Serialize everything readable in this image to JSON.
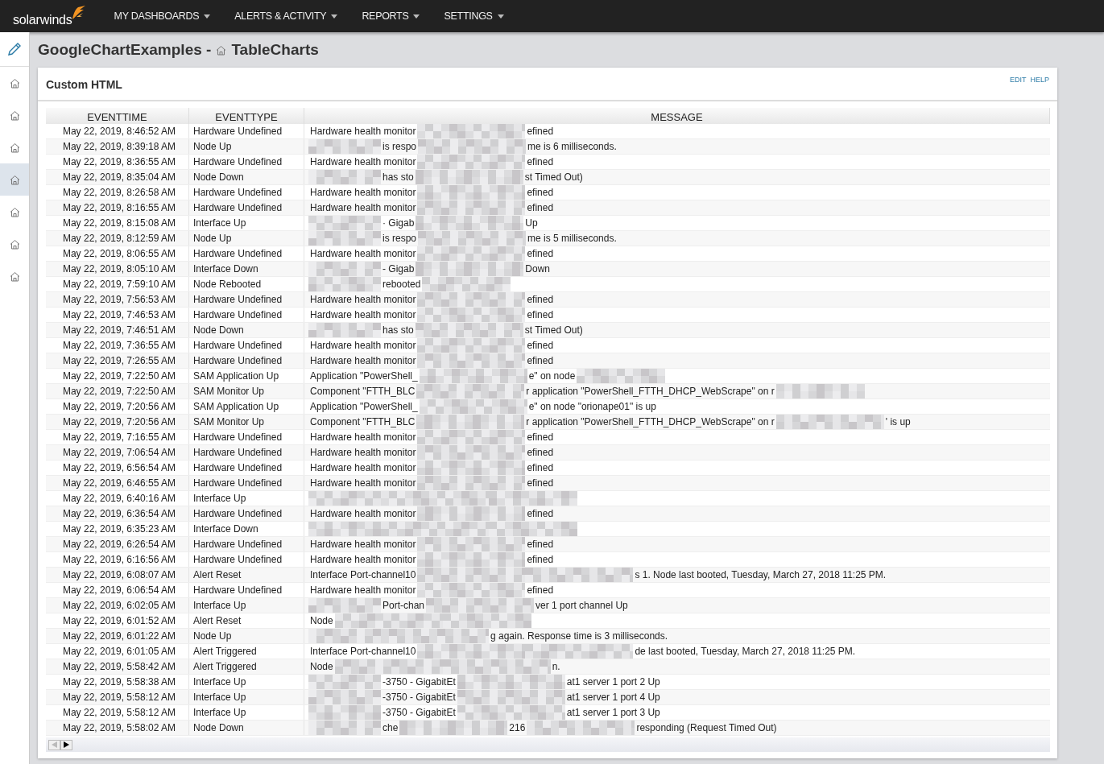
{
  "topbar": {
    "logo": "solarwinds",
    "menu": [
      {
        "label": "MY DASHBOARDS"
      },
      {
        "label": "ALERTS & ACTIVITY"
      },
      {
        "label": "REPORTS"
      },
      {
        "label": "SETTINGS"
      }
    ]
  },
  "sidebar": {
    "items": [
      {
        "selected": false
      },
      {
        "selected": false
      },
      {
        "selected": false
      },
      {
        "selected": true
      },
      {
        "selected": false
      },
      {
        "selected": false
      },
      {
        "selected": false
      }
    ]
  },
  "page": {
    "title": "GoogleChartExamples -",
    "subtitle": "TableCharts"
  },
  "panel": {
    "title": "Custom HTML",
    "links": [
      "EDIT",
      "HELP"
    ]
  },
  "table": {
    "columns": [
      "EVENTTIME",
      "EVENTTYPE",
      "MESSAGE"
    ],
    "rows": [
      {
        "time": "May 22, 2019, 8:46:52 AM",
        "type": "Hardware Undefined",
        "message": [
          {
            "kind": "text",
            "text": "Hardware health monitor"
          },
          {
            "kind": "redacted"
          },
          {
            "kind": "text",
            "text": "efined"
          }
        ]
      },
      {
        "time": "May 22, 2019, 8:39:18 AM",
        "type": "Node Up",
        "message": [
          {
            "kind": "redacted"
          },
          {
            "kind": "text",
            "text": "is respo"
          },
          {
            "kind": "redacted"
          },
          {
            "kind": "text",
            "text": "me is 6 milliseconds."
          }
        ]
      },
      {
        "time": "May 22, 2019, 8:36:55 AM",
        "type": "Hardware Undefined",
        "message": [
          {
            "kind": "text",
            "text": "Hardware health monitor"
          },
          {
            "kind": "redacted"
          },
          {
            "kind": "text",
            "text": "efined"
          }
        ]
      },
      {
        "time": "May 22, 2019, 8:35:04 AM",
        "type": "Node Down",
        "message": [
          {
            "kind": "redacted"
          },
          {
            "kind": "text",
            "text": "has sto"
          },
          {
            "kind": "redacted"
          },
          {
            "kind": "text",
            "text": "st Timed Out)"
          }
        ]
      },
      {
        "time": "May 22, 2019, 8:26:58 AM",
        "type": "Hardware Undefined",
        "message": [
          {
            "kind": "text",
            "text": "Hardware health monitor"
          },
          {
            "kind": "redacted"
          },
          {
            "kind": "text",
            "text": "efined"
          }
        ]
      },
      {
        "time": "May 22, 2019, 8:16:55 AM",
        "type": "Hardware Undefined",
        "message": [
          {
            "kind": "text",
            "text": "Hardware health monitor"
          },
          {
            "kind": "redacted"
          },
          {
            "kind": "text",
            "text": "efined"
          }
        ]
      },
      {
        "time": "May 22, 2019, 8:15:08 AM",
        "type": "Interface Up",
        "message": [
          {
            "kind": "redacted"
          },
          {
            "kind": "text",
            "text": "· Gigab"
          },
          {
            "kind": "redacted"
          },
          {
            "kind": "text",
            "text": "Up"
          }
        ]
      },
      {
        "time": "May 22, 2019, 8:12:59 AM",
        "type": "Node Up",
        "message": [
          {
            "kind": "redacted"
          },
          {
            "kind": "text",
            "text": "is respo"
          },
          {
            "kind": "redacted"
          },
          {
            "kind": "text",
            "text": "me is 5 milliseconds."
          }
        ]
      },
      {
        "time": "May 22, 2019, 8:06:55 AM",
        "type": "Hardware Undefined",
        "message": [
          {
            "kind": "text",
            "text": "Hardware health monitor"
          },
          {
            "kind": "redacted"
          },
          {
            "kind": "text",
            "text": "efined"
          }
        ]
      },
      {
        "time": "May 22, 2019, 8:05:10 AM",
        "type": "Interface Down",
        "message": [
          {
            "kind": "redacted"
          },
          {
            "kind": "text",
            "text": "- Gigab"
          },
          {
            "kind": "redacted"
          },
          {
            "kind": "text",
            "text": "Down"
          }
        ]
      },
      {
        "time": "May 22, 2019, 7:59:10 AM",
        "type": "Node Rebooted",
        "message": [
          {
            "kind": "redacted"
          },
          {
            "kind": "text",
            "text": "rebooted"
          },
          {
            "kind": "redacted"
          }
        ]
      },
      {
        "time": "May 22, 2019, 7:56:53 AM",
        "type": "Hardware Undefined",
        "message": [
          {
            "kind": "text",
            "text": "Hardware health monitor"
          },
          {
            "kind": "redacted"
          },
          {
            "kind": "text",
            "text": "efined"
          }
        ]
      },
      {
        "time": "May 22, 2019, 7:46:53 AM",
        "type": "Hardware Undefined",
        "message": [
          {
            "kind": "text",
            "text": "Hardware health monitor"
          },
          {
            "kind": "redacted"
          },
          {
            "kind": "text",
            "text": "efined"
          }
        ]
      },
      {
        "time": "May 22, 2019, 7:46:51 AM",
        "type": "Node Down",
        "message": [
          {
            "kind": "redacted"
          },
          {
            "kind": "text",
            "text": "has sto"
          },
          {
            "kind": "redacted"
          },
          {
            "kind": "text",
            "text": "st Timed Out)"
          }
        ]
      },
      {
        "time": "May 22, 2019, 7:36:55 AM",
        "type": "Hardware Undefined",
        "message": [
          {
            "kind": "text",
            "text": "Hardware health monitor"
          },
          {
            "kind": "redacted"
          },
          {
            "kind": "text",
            "text": "efined"
          }
        ]
      },
      {
        "time": "May 22, 2019, 7:26:55 AM",
        "type": "Hardware Undefined",
        "message": [
          {
            "kind": "text",
            "text": "Hardware health monitor"
          },
          {
            "kind": "redacted"
          },
          {
            "kind": "text",
            "text": "efined"
          }
        ]
      },
      {
        "time": "May 22, 2019, 7:22:50 AM",
        "type": "SAM Application Up",
        "message": [
          {
            "kind": "text",
            "text": "Application \"PowerShell_"
          },
          {
            "kind": "redacted"
          },
          {
            "kind": "text",
            "text": "e\" on node"
          },
          {
            "kind": "redacted"
          }
        ]
      },
      {
        "time": "May 22, 2019, 7:22:50 AM",
        "type": "SAM Monitor Up",
        "message": [
          {
            "kind": "text",
            "text": "Component \"FTTH_BLC"
          },
          {
            "kind": "redacted"
          },
          {
            "kind": "text",
            "text": "r application \"PowerShell_FTTH_DHCP_WebScrape\" on r"
          },
          {
            "kind": "redacted"
          }
        ]
      },
      {
        "time": "May 22, 2019, 7:20:56 AM",
        "type": "SAM Application Up",
        "message": [
          {
            "kind": "text",
            "text": "Application \"PowerShell_"
          },
          {
            "kind": "redacted"
          },
          {
            "kind": "text",
            "text": "e\" on node \"orionape01\" is up"
          }
        ]
      },
      {
        "time": "May 22, 2019, 7:20:56 AM",
        "type": "SAM Monitor Up",
        "message": [
          {
            "kind": "text",
            "text": "Component \"FTTH_BLC"
          },
          {
            "kind": "redacted"
          },
          {
            "kind": "text",
            "text": "r application \"PowerShell_FTTH_DHCP_WebScrape\" on r"
          },
          {
            "kind": "redacted"
          },
          {
            "kind": "text",
            "text": "' is up"
          }
        ]
      },
      {
        "time": "May 22, 2019, 7:16:55 AM",
        "type": "Hardware Undefined",
        "message": [
          {
            "kind": "text",
            "text": "Hardware health monitor"
          },
          {
            "kind": "redacted"
          },
          {
            "kind": "text",
            "text": "efined"
          }
        ]
      },
      {
        "time": "May 22, 2019, 7:06:54 AM",
        "type": "Hardware Undefined",
        "message": [
          {
            "kind": "text",
            "text": "Hardware health monitor"
          },
          {
            "kind": "redacted"
          },
          {
            "kind": "text",
            "text": "efined"
          }
        ]
      },
      {
        "time": "May 22, 2019, 6:56:54 AM",
        "type": "Hardware Undefined",
        "message": [
          {
            "kind": "text",
            "text": "Hardware health monitor"
          },
          {
            "kind": "redacted"
          },
          {
            "kind": "text",
            "text": "efined"
          }
        ]
      },
      {
        "time": "May 22, 2019, 6:46:55 AM",
        "type": "Hardware Undefined",
        "message": [
          {
            "kind": "text",
            "text": "Hardware health monitor"
          },
          {
            "kind": "redacted"
          },
          {
            "kind": "text",
            "text": "efined"
          }
        ]
      },
      {
        "time": "May 22, 2019, 6:40:16 AM",
        "type": "Interface Up",
        "message": [
          {
            "kind": "redacted"
          },
          {
            "kind": "redacted"
          },
          {
            "kind": "redacted"
          }
        ]
      },
      {
        "time": "May 22, 2019, 6:36:54 AM",
        "type": "Hardware Undefined",
        "message": [
          {
            "kind": "text",
            "text": "Hardware health monitor"
          },
          {
            "kind": "redacted"
          },
          {
            "kind": "text",
            "text": "efined"
          }
        ]
      },
      {
        "time": "May 22, 2019, 6:35:23 AM",
        "type": "Interface Down",
        "message": [
          {
            "kind": "redacted"
          },
          {
            "kind": "redacted"
          },
          {
            "kind": "redacted"
          }
        ]
      },
      {
        "time": "May 22, 2019, 6:26:54 AM",
        "type": "Hardware Undefined",
        "message": [
          {
            "kind": "text",
            "text": "Hardware health monitor"
          },
          {
            "kind": "redacted"
          },
          {
            "kind": "text",
            "text": "efined"
          }
        ]
      },
      {
        "time": "May 22, 2019, 6:16:56 AM",
        "type": "Hardware Undefined",
        "message": [
          {
            "kind": "text",
            "text": "Hardware health monitor"
          },
          {
            "kind": "redacted"
          },
          {
            "kind": "text",
            "text": "efined"
          }
        ]
      },
      {
        "time": "May 22, 2019, 6:08:07 AM",
        "type": "Alert Reset",
        "message": [
          {
            "kind": "text",
            "text": "Interface Port-channel10"
          },
          {
            "kind": "redacted"
          },
          {
            "kind": "redacted"
          },
          {
            "kind": "text",
            "text": "s 1. Node last booted, Tuesday, March 27, 2018 11:25 PM."
          }
        ]
      },
      {
        "time": "May 22, 2019, 6:06:54 AM",
        "type": "Hardware Undefined",
        "message": [
          {
            "kind": "text",
            "text": "Hardware health monitor"
          },
          {
            "kind": "redacted"
          },
          {
            "kind": "text",
            "text": "efined"
          }
        ]
      },
      {
        "time": "May 22, 2019, 6:02:05 AM",
        "type": "Interface Up",
        "message": [
          {
            "kind": "redacted"
          },
          {
            "kind": "text",
            "text": "Port-chan"
          },
          {
            "kind": "redacted"
          },
          {
            "kind": "text",
            "text": "ver 1 port channel Up"
          }
        ]
      },
      {
        "time": "May 22, 2019, 6:01:52 AM",
        "type": "Alert Reset",
        "message": [
          {
            "kind": "text",
            "text": "Node"
          },
          {
            "kind": "redacted"
          },
          {
            "kind": "redacted"
          }
        ]
      },
      {
        "time": "May 22, 2019, 6:01:22 AM",
        "type": "Node Up",
        "message": [
          {
            "kind": "redacted"
          },
          {
            "kind": "redacted"
          },
          {
            "kind": "text",
            "text": "g again. Response time is 3 milliseconds."
          }
        ]
      },
      {
        "time": "May 22, 2019, 6:01:05 AM",
        "type": "Alert Triggered",
        "message": [
          {
            "kind": "text",
            "text": "Interface Port-channel10"
          },
          {
            "kind": "redacted"
          },
          {
            "kind": "redacted"
          },
          {
            "kind": "text",
            "text": "de last booted, Tuesday, March 27, 2018 11:25 PM."
          }
        ]
      },
      {
        "time": "May 22, 2019, 5:58:42 AM",
        "type": "Alert Triggered",
        "message": [
          {
            "kind": "text",
            "text": "Node"
          },
          {
            "kind": "redacted"
          },
          {
            "kind": "redacted"
          },
          {
            "kind": "text",
            "text": "n."
          }
        ]
      },
      {
        "time": "May 22, 2019, 5:58:38 AM",
        "type": "Interface Up",
        "message": [
          {
            "kind": "redacted"
          },
          {
            "kind": "text",
            "text": "-3750 - GigabitEt"
          },
          {
            "kind": "redacted"
          },
          {
            "kind": "text",
            "text": "at1 server 1 port 2 Up"
          }
        ]
      },
      {
        "time": "May 22, 2019, 5:58:12 AM",
        "type": "Interface Up",
        "message": [
          {
            "kind": "redacted"
          },
          {
            "kind": "text",
            "text": "-3750 - GigabitEt"
          },
          {
            "kind": "redacted"
          },
          {
            "kind": "text",
            "text": "at1 server 1 port 4 Up"
          }
        ]
      },
      {
        "time": "May 22, 2019, 5:58:12 AM",
        "type": "Interface Up",
        "message": [
          {
            "kind": "redacted"
          },
          {
            "kind": "text",
            "text": "-3750 - GigabitEt"
          },
          {
            "kind": "redacted"
          },
          {
            "kind": "text",
            "text": "at1 server 1 port 3 Up"
          }
        ]
      },
      {
        "time": "May 22, 2019, 5:58:02 AM",
        "type": "Node Down",
        "message": [
          {
            "kind": "redacted"
          },
          {
            "kind": "text",
            "text": "che"
          },
          {
            "kind": "redacted"
          },
          {
            "kind": "text",
            "text": "216"
          },
          {
            "kind": "redacted"
          },
          {
            "kind": "text",
            "text": "responding (Request Timed Out)"
          }
        ]
      }
    ]
  },
  "scroll_buttons": [
    {
      "disabled": true
    },
    {
      "disabled": false
    }
  ]
}
